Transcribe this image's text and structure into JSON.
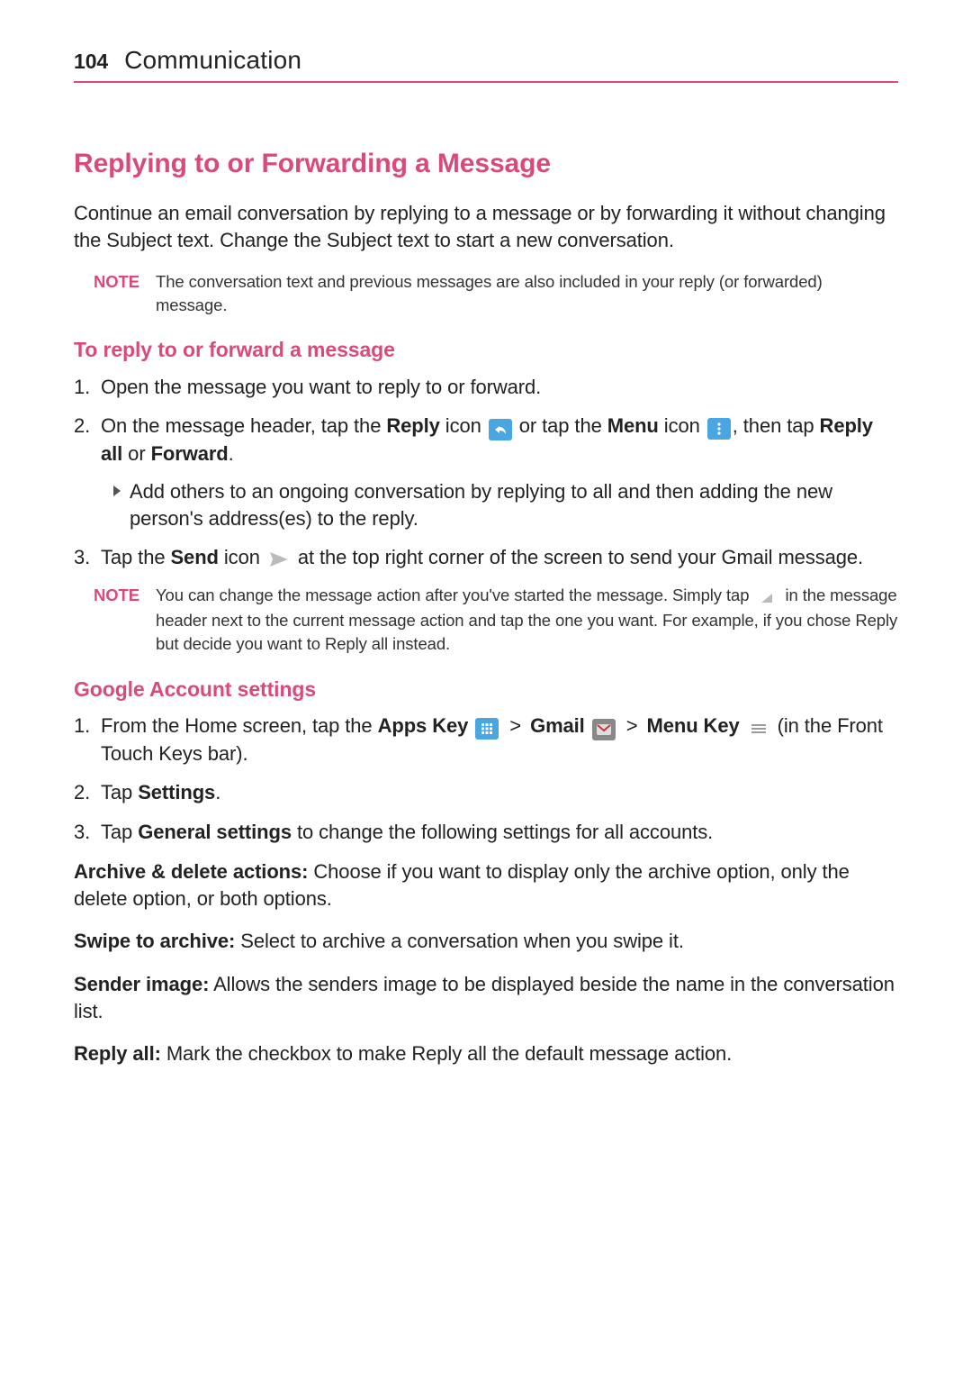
{
  "page_number": "104",
  "section_title": "Communication",
  "heading": "Replying to or Forwarding a Message",
  "intro": "Continue an email conversation by replying to a message or by forwarding it without changing the Subject text. Change the Subject text to start a new conversation.",
  "note1": {
    "label": "NOTE",
    "text": "The conversation text and previous messages are also included in your reply (or forwarded) message."
  },
  "sub1": {
    "title": "To reply to or forward a message",
    "step1": {
      "num": "1.",
      "text": "Open the message you want to reply to or forward."
    },
    "step2": {
      "num": "2.",
      "t1": "On the message header, tap the ",
      "reply_bold": "Reply",
      "t2": " icon ",
      "t3": " or tap the ",
      "menu_bold": "Menu",
      "t4": " icon ",
      "t5": ", then tap ",
      "replyall_bold": "Reply all",
      "t6": " or ",
      "forward_bold": "Forward",
      "t7": ".",
      "bullet": "Add others to an ongoing conversation by replying to all and then adding the new person's address(es) to the reply."
    },
    "step3": {
      "num": "3.",
      "t1": "Tap the ",
      "send_bold": "Send",
      "t2": " icon ",
      "t3": " at the top right corner of the screen to send your Gmail message."
    }
  },
  "note2": {
    "label": "NOTE",
    "t1": "You can change the message action after you've started the message. Simply tap ",
    "t2": " in the message header next to the current message action and tap the one you want. For example, if you chose Reply but decide you want to Reply all instead."
  },
  "sub2": {
    "title": "Google Account settings",
    "step1": {
      "num": "1.",
      "t1": "From the Home screen, tap the ",
      "apps_bold": "Apps Key",
      "gt": ">",
      "gmail_bold": "Gmail",
      "menukey_bold": "Menu Key",
      "t2": " (in the Front Touch Keys bar)."
    },
    "step2": {
      "num": "2.",
      "t1": "Tap ",
      "settings_bold": "Settings",
      "t2": "."
    },
    "step3": {
      "num": "3.",
      "t1": "Tap ",
      "general_bold": "General settings",
      "t2": " to change the following settings for all accounts."
    }
  },
  "para1": {
    "bold": "Archive & delete actions:",
    "text": " Choose if you want to display only the archive option, only the delete option, or both options."
  },
  "para2": {
    "bold": "Swipe to archive:",
    "text": " Select to archive a conversation when you swipe it."
  },
  "para3": {
    "bold": "Sender image:",
    "text": " Allows the senders image to be displayed beside the name in the conversation list."
  },
  "para4": {
    "bold": "Reply all:",
    "text": " Mark the checkbox to make Reply all the default message action."
  }
}
